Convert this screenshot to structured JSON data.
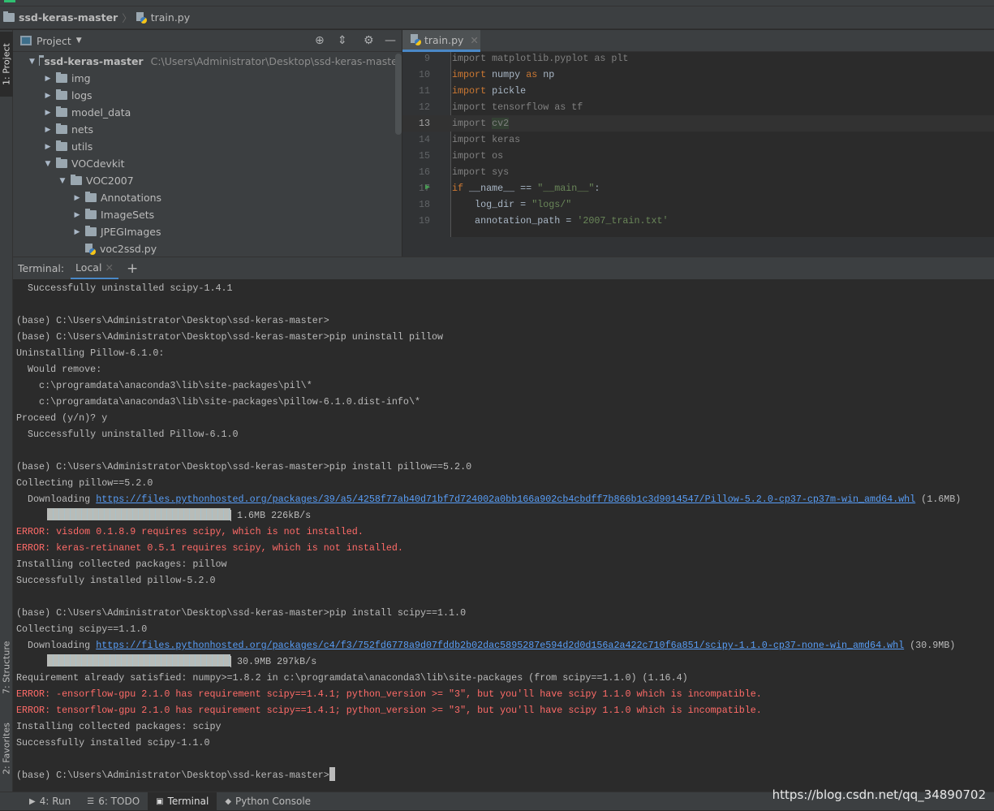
{
  "breadcrumb": {
    "project": "ssd-keras-master",
    "file": "train.py"
  },
  "left_strip": {
    "project_tab": "1: Project",
    "structure_tab": "7: Structure",
    "favorites_tab": "2: Favorites"
  },
  "project_panel": {
    "title": "Project",
    "tree": [
      {
        "label": "ssd-keras-master",
        "path": "C:\\Users\\Administrator\\Desktop\\ssd-keras-master",
        "level": 0,
        "expanded": true,
        "bold": true
      },
      {
        "label": "img",
        "level": 1,
        "expanded": false
      },
      {
        "label": "logs",
        "level": 1,
        "expanded": false
      },
      {
        "label": "model_data",
        "level": 1,
        "expanded": false
      },
      {
        "label": "nets",
        "level": 1,
        "expanded": false
      },
      {
        "label": "utils",
        "level": 1,
        "expanded": false
      },
      {
        "label": "VOCdevkit",
        "level": 1,
        "expanded": true
      },
      {
        "label": "VOC2007",
        "level": 2,
        "expanded": true
      },
      {
        "label": "Annotations",
        "level": 3,
        "expanded": false
      },
      {
        "label": "ImageSets",
        "level": 3,
        "expanded": false
      },
      {
        "label": "JPEGImages",
        "level": 3,
        "expanded": false
      },
      {
        "label": "voc2ssd.py",
        "level": 3,
        "file": true
      }
    ]
  },
  "editor": {
    "tab": "train.py",
    "current_line": 13,
    "lines": [
      {
        "n": "9",
        "segs": [
          [
            "dim",
            "import matplotlib.pyplot as plt"
          ]
        ]
      },
      {
        "n": "10",
        "segs": [
          [
            "kw",
            "import "
          ],
          [
            "norm",
            "numpy "
          ],
          [
            "kw",
            "as "
          ],
          [
            "norm",
            "np"
          ]
        ]
      },
      {
        "n": "11",
        "segs": [
          [
            "kw",
            "import "
          ],
          [
            "norm",
            "pickle"
          ]
        ]
      },
      {
        "n": "12",
        "segs": [
          [
            "dim",
            "import tensorflow as tf"
          ]
        ]
      },
      {
        "n": "13",
        "segs": [
          [
            "dim",
            "import "
          ],
          [
            "dim hl",
            "cv2"
          ]
        ]
      },
      {
        "n": "14",
        "segs": [
          [
            "dim",
            "import keras"
          ]
        ]
      },
      {
        "n": "15",
        "segs": [
          [
            "dim",
            "import os"
          ]
        ]
      },
      {
        "n": "16",
        "segs": [
          [
            "dim",
            "import sys"
          ]
        ]
      },
      {
        "n": "17",
        "segs": [
          [
            "kw",
            "if "
          ],
          [
            "norm",
            "__name__ == "
          ],
          [
            "str",
            "\"__main__\""
          ],
          [
            "norm",
            ":"
          ]
        ],
        "run": true
      },
      {
        "n": "18",
        "segs": [
          [
            "norm",
            "    log_dir = "
          ],
          [
            "str",
            "\"logs/\""
          ]
        ]
      },
      {
        "n": "19",
        "segs": [
          [
            "norm",
            "    annotation_path = "
          ],
          [
            "str",
            "'2007_train.txt'"
          ]
        ]
      }
    ]
  },
  "terminal": {
    "label": "Terminal:",
    "tab": "Local",
    "add": "+",
    "lines": [
      {
        "t": "  Successfully uninstalled scipy-1.4.1"
      },
      {
        "t": ""
      },
      {
        "t": "(base) C:\\Users\\Administrator\\Desktop\\ssd-keras-master>"
      },
      {
        "t": "(base) C:\\Users\\Administrator\\Desktop\\ssd-keras-master>pip uninstall pillow"
      },
      {
        "t": "Uninstalling Pillow-6.1.0:"
      },
      {
        "t": "  Would remove:"
      },
      {
        "t": "    c:\\programdata\\anaconda3\\lib\\site-packages\\pil\\*"
      },
      {
        "t": "    c:\\programdata\\anaconda3\\lib\\site-packages\\pillow-6.1.0.dist-info\\*"
      },
      {
        "t": "Proceed (y/n)? y"
      },
      {
        "t": "  Successfully uninstalled Pillow-6.1.0"
      },
      {
        "t": ""
      },
      {
        "t": "(base) C:\\Users\\Administrator\\Desktop\\ssd-keras-master>pip install pillow==5.2.0"
      },
      {
        "t": "Collecting pillow==5.2.0"
      },
      {
        "t": "  Downloading ",
        "url": "https://files.pythonhosted.org/packages/39/a5/4258f77ab40d71bf7d724002a0bb166a902cb4cbdff7b866b1c3d9014547/Pillow-5.2.0-cp37-cp37m-win_amd64.whl",
        "after": " (1.6MB)"
      },
      {
        "progress": 100,
        "t": " 1.6MB 226kB/s"
      },
      {
        "t": "ERROR: visdom 0.1.8.9 requires scipy, which is not installed.",
        "err": true
      },
      {
        "t": "ERROR: keras-retinanet 0.5.1 requires scipy, which is not installed.",
        "err": true
      },
      {
        "t": "Installing collected packages: pillow"
      },
      {
        "t": "Successfully installed pillow-5.2.0"
      },
      {
        "t": ""
      },
      {
        "t": "(base) C:\\Users\\Administrator\\Desktop\\ssd-keras-master>pip install scipy==1.1.0"
      },
      {
        "t": "Collecting scipy==1.1.0"
      },
      {
        "t": "  Downloading ",
        "url": "https://files.pythonhosted.org/packages/c4/f3/752fd6778a9d07fddb2b02dac5895287e594d2d0d156a2a422c710f6a851/scipy-1.1.0-cp37-none-win_amd64.whl",
        "after": " (30.9MB)"
      },
      {
        "progress": 100,
        "t": " 30.9MB 297kB/s"
      },
      {
        "t": "Requirement already satisfied: numpy>=1.8.2 in c:\\programdata\\anaconda3\\lib\\site-packages (from scipy==1.1.0) (1.16.4)"
      },
      {
        "t": "ERROR: -ensorflow-gpu 2.1.0 has requirement scipy==1.4.1; python_version >= \"3\", but you'll have scipy 1.1.0 which is incompatible.",
        "err": true
      },
      {
        "t": "ERROR: tensorflow-gpu 2.1.0 has requirement scipy==1.4.1; python_version >= \"3\", but you'll have scipy 1.1.0 which is incompatible.",
        "err": true
      },
      {
        "t": "Installing collected packages: scipy"
      },
      {
        "t": "Successfully installed scipy-1.1.0"
      },
      {
        "t": ""
      },
      {
        "t": "(base) C:\\Users\\Administrator\\Desktop\\ssd-keras-master>",
        "cursor": true
      }
    ]
  },
  "bottom_tabs": [
    {
      "label": "4: Run",
      "icon": "run-icon"
    },
    {
      "label": "6: TODO",
      "icon": "list-icon"
    },
    {
      "label": "Terminal",
      "icon": "terminal-icon",
      "active": true
    },
    {
      "label": "Python Console",
      "icon": "python-icon"
    }
  ],
  "watermark": "https://blog.csdn.net/qq_34890702"
}
